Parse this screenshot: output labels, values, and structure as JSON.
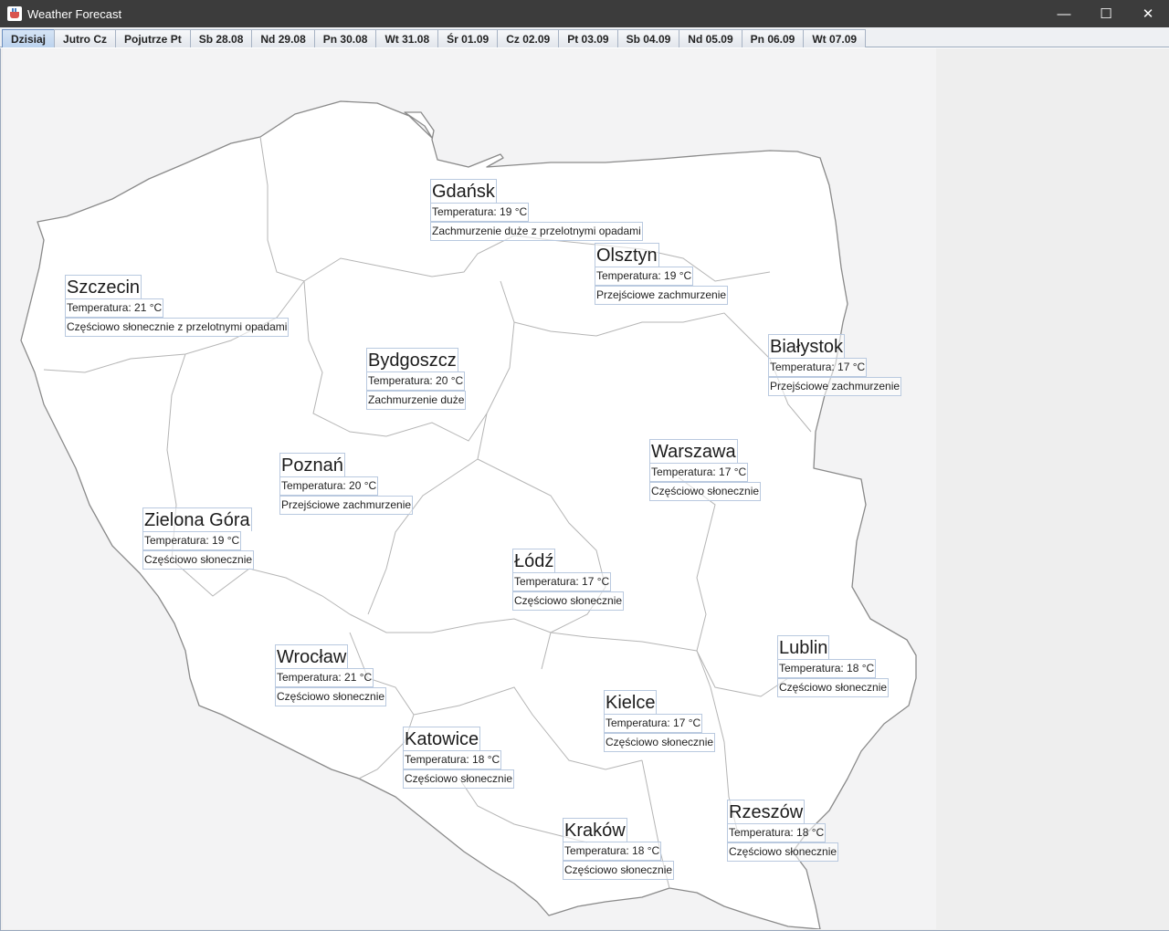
{
  "window": {
    "title": "Weather Forecast",
    "controls": {
      "minimize": "—",
      "maximize": "☐",
      "close": "✕"
    }
  },
  "tabs": [
    {
      "label": "Dzisiaj",
      "active": true
    },
    {
      "label": "Jutro Cz",
      "active": false
    },
    {
      "label": "Pojutrze Pt",
      "active": false
    },
    {
      "label": "Sb 28.08",
      "active": false
    },
    {
      "label": "Nd 29.08",
      "active": false
    },
    {
      "label": "Pn 30.08",
      "active": false
    },
    {
      "label": "Wt 31.08",
      "active": false
    },
    {
      "label": "Śr 01.09",
      "active": false
    },
    {
      "label": "Cz 02.09",
      "active": false
    },
    {
      "label": "Pt 03.09",
      "active": false
    },
    {
      "label": "Sb 04.09",
      "active": false
    },
    {
      "label": "Nd 05.09",
      "active": false
    },
    {
      "label": "Pn 06.09",
      "active": false
    },
    {
      "label": "Wt 07.09",
      "active": false
    }
  ],
  "cities": [
    {
      "name": "Gdańsk",
      "temperature": "Temperatura: 19 °C",
      "condition": "Zachmurzenie duże z przelotnymi opadami"
    },
    {
      "name": "Olsztyn",
      "temperature": "Temperatura: 19 °C",
      "condition": "Przejściowe zachmurzenie"
    },
    {
      "name": "Szczecin",
      "temperature": "Temperatura: 21 °C",
      "condition": "Częściowo słonecznie z przelotnymi opadami"
    },
    {
      "name": "Białystok",
      "temperature": "Temperatura: 17 °C",
      "condition": "Przejściowe zachmurzenie"
    },
    {
      "name": "Bydgoszcz",
      "temperature": "Temperatura: 20 °C",
      "condition": "Zachmurzenie duże"
    },
    {
      "name": "Warszawa",
      "temperature": "Temperatura: 17 °C",
      "condition": "Częściowo słonecznie"
    },
    {
      "name": "Poznań",
      "temperature": "Temperatura: 20 °C",
      "condition": "Przejściowe zachmurzenie"
    },
    {
      "name": "Zielona Góra",
      "temperature": "Temperatura: 19 °C",
      "condition": "Częściowo słonecznie"
    },
    {
      "name": "Łódź",
      "temperature": "Temperatura: 17 °C",
      "condition": "Częściowo słonecznie"
    },
    {
      "name": "Lublin",
      "temperature": "Temperatura: 18 °C",
      "condition": "Częściowo słonecznie"
    },
    {
      "name": "Wrocław",
      "temperature": "Temperatura: 21 °C",
      "condition": "Częściowo słonecznie"
    },
    {
      "name": "Kielce",
      "temperature": "Temperatura: 17 °C",
      "condition": "Częściowo słonecznie"
    },
    {
      "name": "Katowice",
      "temperature": "Temperatura: 18 °C",
      "condition": "Częściowo słonecznie"
    },
    {
      "name": "Rzeszów",
      "temperature": "Temperatura: 18 °C",
      "condition": "Częściowo słonecznie"
    },
    {
      "name": "Kraków",
      "temperature": "Temperatura: 18 °C",
      "condition": "Częściowo słonecznie"
    }
  ],
  "colors": {
    "titlebar": "#3c3c3c",
    "active_tab": "#bcd3ee",
    "map_fill": "#ffffff",
    "map_border": "#8a8a8a",
    "label_border": "#b9c9df"
  }
}
